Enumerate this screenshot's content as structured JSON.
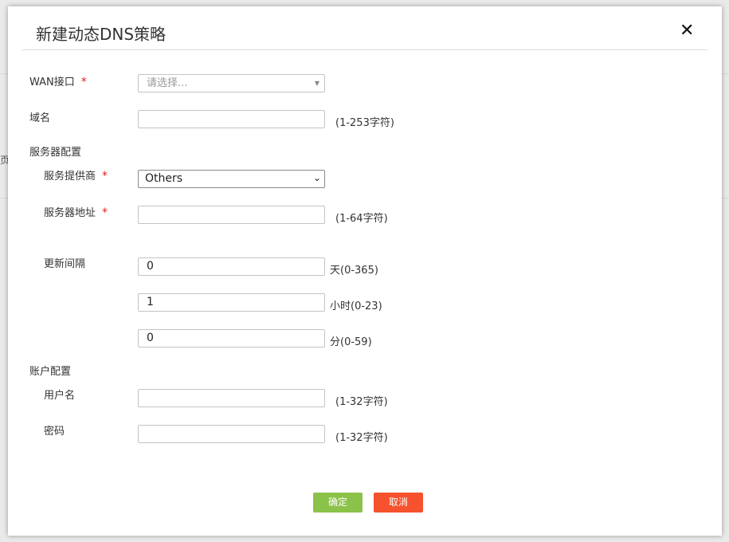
{
  "dialog": {
    "title": "新建动态DNS策略",
    "close_glyph": "✕"
  },
  "wan": {
    "label": "WAN接口",
    "required": "*",
    "placeholder": "请选择..."
  },
  "domain": {
    "label": "域名",
    "value": "",
    "hint": "(1-253字符)"
  },
  "server_section": {
    "label": "服务器配置"
  },
  "provider": {
    "label": "服务提供商",
    "required": "*",
    "value": "Others"
  },
  "server_address": {
    "label": "服务器地址",
    "required": "*",
    "value": "",
    "hint": "(1-64字符)"
  },
  "interval": {
    "label": "更新间隔",
    "days": {
      "value": "0",
      "hint": "天(0-365)"
    },
    "hours": {
      "value": "1",
      "hint": "小时(0-23)"
    },
    "minutes": {
      "value": "0",
      "hint": "分(0-59)"
    }
  },
  "account_section": {
    "label": "账户配置"
  },
  "username": {
    "label": "用户名",
    "value": "",
    "hint": "(1-32字符)"
  },
  "password": {
    "label": "密码",
    "value": "",
    "hint": "(1-32字符)"
  },
  "buttons": {
    "ok": "确定",
    "cancel": "取消"
  },
  "colors": {
    "ok": "#8bc34a",
    "cancel": "#f5522d",
    "required": "#e02020"
  },
  "background": {
    "edge_glyph": "页"
  }
}
